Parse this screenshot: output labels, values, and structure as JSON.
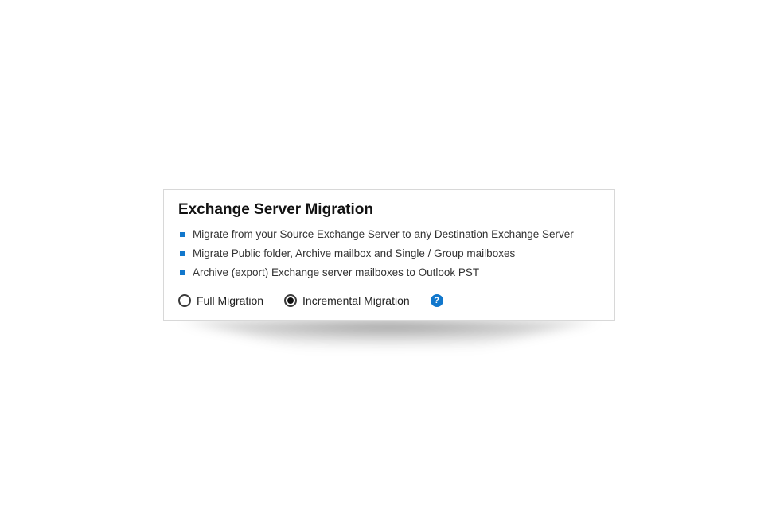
{
  "panel": {
    "title": "Exchange Server Migration",
    "features": [
      "Migrate from your Source Exchange Server to any Destination Exchange Server",
      "Migrate Public folder, Archive mailbox and Single / Group mailboxes",
      "Archive (export) Exchange server mailboxes to Outlook PST"
    ],
    "options": {
      "full": {
        "label": "Full Migration",
        "selected": false
      },
      "incremental": {
        "label": "Incremental Migration",
        "selected": true
      }
    },
    "help_glyph": "?"
  }
}
